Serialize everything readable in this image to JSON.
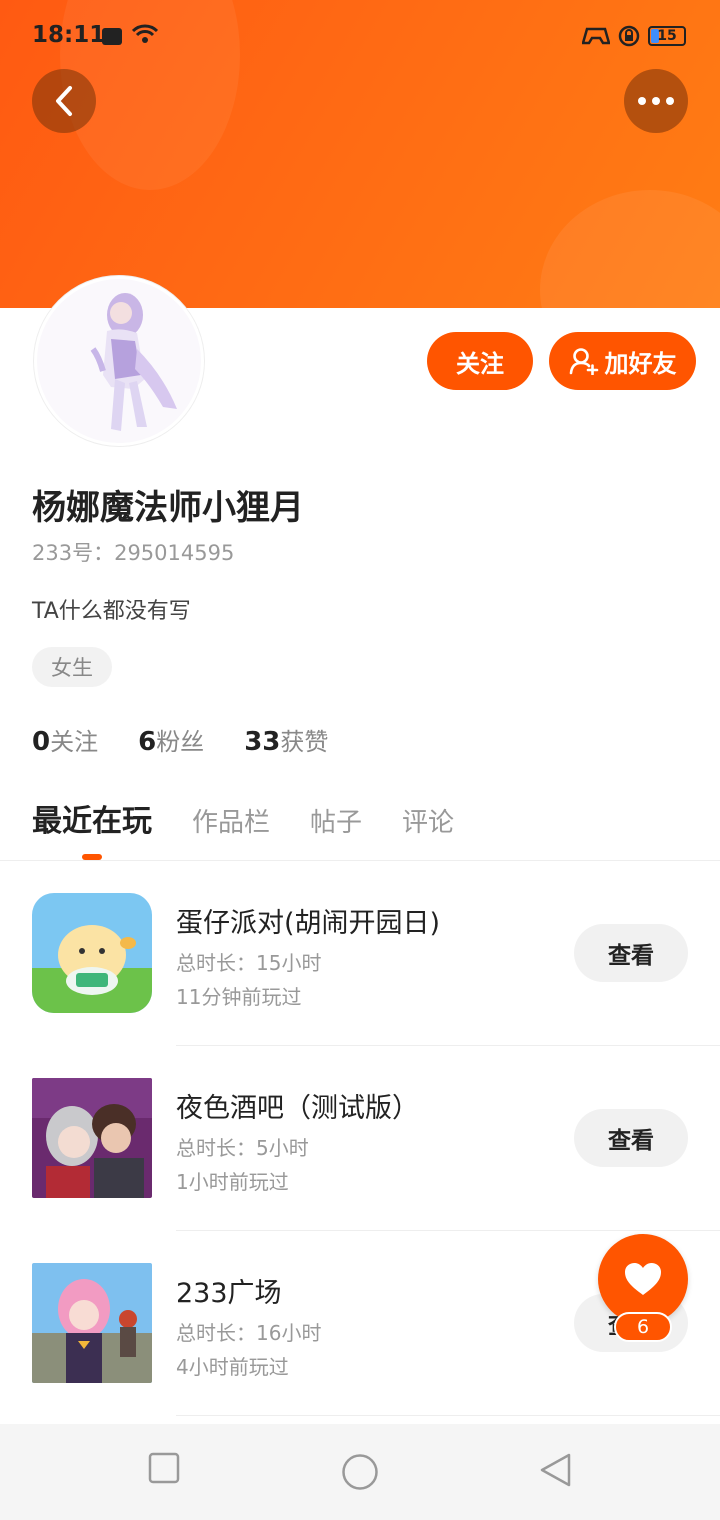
{
  "status_bar": {
    "time": "18:11",
    "battery": "15"
  },
  "profile": {
    "name": "杨娜魔法师小狸月",
    "id_label": "233号：295014595",
    "bio": "TA什么都没有写",
    "gender": "女生",
    "follow_label": "关注",
    "add_friend_label": "加好友"
  },
  "stats": [
    {
      "value": "0",
      "label": "关注"
    },
    {
      "value": "6",
      "label": "粉丝"
    },
    {
      "value": "33",
      "label": "获赞"
    }
  ],
  "tabs": [
    "最近在玩",
    "作品栏",
    "帖子",
    "评论"
  ],
  "games": [
    {
      "title": "蛋仔派对(胡闹开园日)",
      "duration": "总时长：15小时",
      "last_played": "11分钟前玩过",
      "button": "查看"
    },
    {
      "title": "夜色酒吧（测试版）",
      "duration": "总时长：5小时",
      "last_played": "1小时前玩过",
      "button": "查看"
    },
    {
      "title": "233广场",
      "duration": "总时长：16小时",
      "last_played": "4小时前玩过",
      "button": "查看"
    }
  ],
  "like_fab": {
    "count": "6"
  },
  "colors": {
    "accent": "#ff5500",
    "banner": "#ff6a14"
  },
  "icons": [
    "back-icon",
    "more-icon",
    "add-friend-icon",
    "heart-icon",
    "nav-recents-icon",
    "nav-home-icon",
    "nav-back-icon"
  ]
}
